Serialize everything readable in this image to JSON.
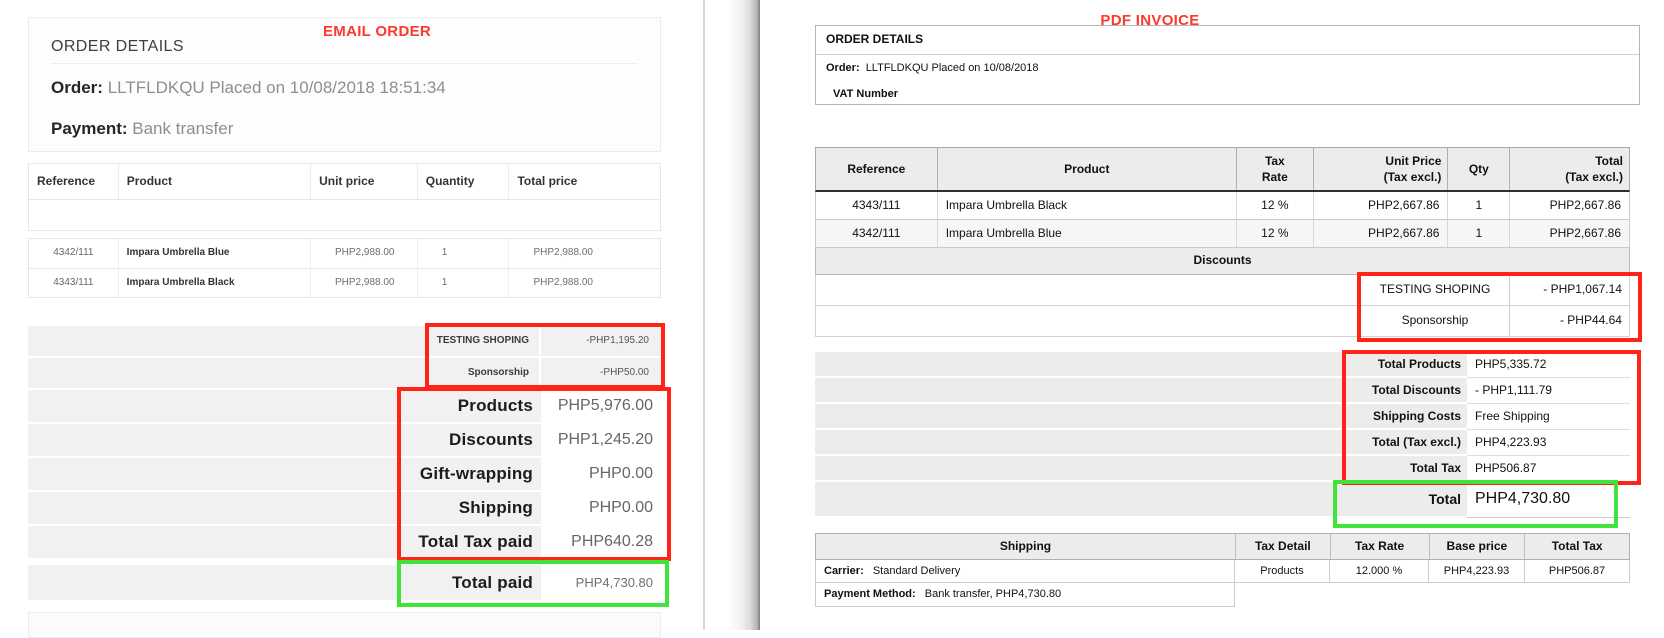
{
  "colors": {
    "annotation_red": "#ff2318",
    "annotation_green": "#3fe33a",
    "heading_red": "#fb3a2d"
  },
  "email_panel": {
    "annotation": "EMAIL ORDER",
    "order_details_title": "ORDER DETAILS",
    "order_label": "Order:",
    "order_value": "LLTFLDKQU Placed on 10/08/2018 18:51:34",
    "payment_label": "Payment:",
    "payment_value": "Bank transfer",
    "table": {
      "headers": [
        "Reference",
        "Product",
        "Unit price",
        "Quantity",
        "Total price"
      ],
      "rows": [
        {
          "reference": "4342/111",
          "product": "Impara Umbrella Blue",
          "unit_price": "PHP2,988.00",
          "quantity": "1",
          "total_price": "PHP2,988.00"
        },
        {
          "reference": "4343/111",
          "product": "Impara Umbrella Black",
          "unit_price": "PHP2,988.00",
          "quantity": "1",
          "total_price": "PHP2,988.00"
        }
      ]
    },
    "discounts": [
      {
        "label": "TESTING SHOPING",
        "value": "-PHP1,195.20"
      },
      {
        "label": "Sponsorship",
        "value": "-PHP50.00"
      }
    ],
    "totals": [
      {
        "label": "Products",
        "value": "PHP5,976.00"
      },
      {
        "label": "Discounts",
        "value": "PHP1,245.20"
      },
      {
        "label": "Gift-wrapping",
        "value": "PHP0.00"
      },
      {
        "label": "Shipping",
        "value": "PHP0.00"
      },
      {
        "label": "Total Tax paid",
        "value": "PHP640.28"
      }
    ],
    "total_paid": {
      "label": "Total paid",
      "value": "PHP4,730.80"
    }
  },
  "pdf_panel": {
    "annotation": "PDF INVOICE",
    "order_details_title": "ORDER DETAILS",
    "order_label": "Order:",
    "order_value": "LLTFLDKQU Placed on 10/08/2018",
    "vat_label": "VAT Number",
    "product_table": {
      "headers": [
        {
          "top": "Reference",
          "bottom": ""
        },
        {
          "top": "Product",
          "bottom": ""
        },
        {
          "top": "Tax",
          "bottom": "Rate"
        },
        {
          "top": "Unit Price",
          "bottom": "(Tax excl.)"
        },
        {
          "top": "Qty",
          "bottom": ""
        },
        {
          "top": "Total",
          "bottom": "(Tax excl.)"
        }
      ],
      "rows": [
        {
          "reference": "4343/111",
          "product": "Impara Umbrella Black",
          "tax_rate": "12 %",
          "unit_price": "PHP2,667.86",
          "qty": "1",
          "total": "PHP2,667.86"
        },
        {
          "reference": "4342/111",
          "product": "Impara Umbrella Blue",
          "tax_rate": "12 %",
          "unit_price": "PHP2,667.86",
          "qty": "1",
          "total": "PHP2,667.86"
        }
      ]
    },
    "discounts_header": "Discounts",
    "discounts": [
      {
        "label": "TESTING SHOPING",
        "value": "- PHP1,067.14"
      },
      {
        "label": "Sponsorship",
        "value": "- PHP44.64"
      }
    ],
    "totals": [
      {
        "label": "Total Products",
        "value": "PHP5,335.72"
      },
      {
        "label": "Total Discounts",
        "value": "- PHP1,111.79"
      },
      {
        "label": "Shipping Costs",
        "value": "Free Shipping"
      },
      {
        "label": "Total (Tax excl.)",
        "value": "PHP4,223.93"
      },
      {
        "label": "Total Tax",
        "value": "PHP506.87"
      }
    ],
    "grand_total": {
      "label": "Total",
      "value": "PHP4,730.80"
    },
    "shipping": {
      "headers": [
        "Shipping",
        "Tax Detail",
        "Tax Rate",
        "Base price",
        "Total Tax"
      ],
      "carrier_label": "Carrier:",
      "carrier_value": "Standard Delivery",
      "tax_detail": "Products",
      "tax_rate": "12.000 %",
      "base_price": "PHP4,223.93",
      "total_tax": "PHP506.87",
      "payment_method_label": "Payment Method:",
      "payment_method_value": "Bank transfer, PHP4,730.80"
    }
  }
}
